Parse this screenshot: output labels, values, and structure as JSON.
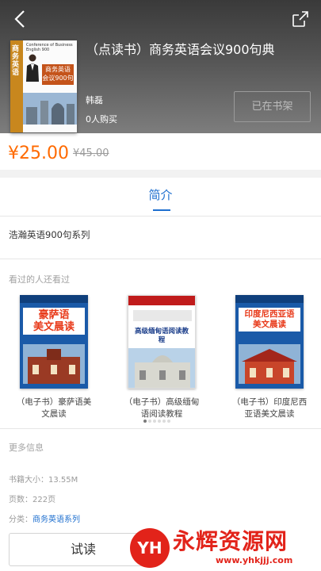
{
  "header": {
    "back_icon": "back-arrow-icon",
    "share_icon": "share-icon",
    "title": "（点读书）商务英语会议900句典",
    "author": "韩磊",
    "buyers": "0人购买",
    "shelf_button": "已在书架",
    "cover": {
      "spine_text": "商务英语",
      "conference_text": "Conference of Business English 900",
      "badge_line1": "商务英语",
      "badge_line2": "会议900句"
    }
  },
  "price": {
    "current": "¥25.00",
    "original": "¥45.00"
  },
  "tabs": {
    "intro": "简介"
  },
  "intro": {
    "description": "浩瀚英语900句系列"
  },
  "recommendations": {
    "label": "看过的人还看过",
    "items": [
      {
        "cover_title": "豪萨语\n美文晨读",
        "caption": "（电子书）豪萨语美文晨读",
        "cover_color": "#1a5aa8",
        "title_color": "#e83a1a"
      },
      {
        "cover_title": "高级缅甸语阅读教程",
        "caption": "（电子书）高级缅甸语阅读教程",
        "cover_color": "#ffffff",
        "title_color": "#1a3d8a"
      },
      {
        "cover_title": "印度尼西亚语\n美文晨读",
        "caption": "（电子书）印度尼西亚语美文晨读",
        "cover_color": "#1a5aa8",
        "title_color": "#e83a1a"
      }
    ],
    "pages": 6,
    "active_page": 1
  },
  "more_info": {
    "label": "更多信息",
    "size_label": "书籍大小：",
    "size_value": "13.55M",
    "pages_label": "页数：",
    "pages_value": "222页",
    "category_label": "分类：",
    "category_value": "商务英语系列"
  },
  "bottom": {
    "read_button": "试读"
  },
  "watermark": {
    "logo": "YH",
    "name": "永辉资源网",
    "url": "www.yhkjjj.com"
  },
  "colors": {
    "accent": "#1e6fcf",
    "price": "#ff6a00",
    "watermark": "#e2231a"
  }
}
